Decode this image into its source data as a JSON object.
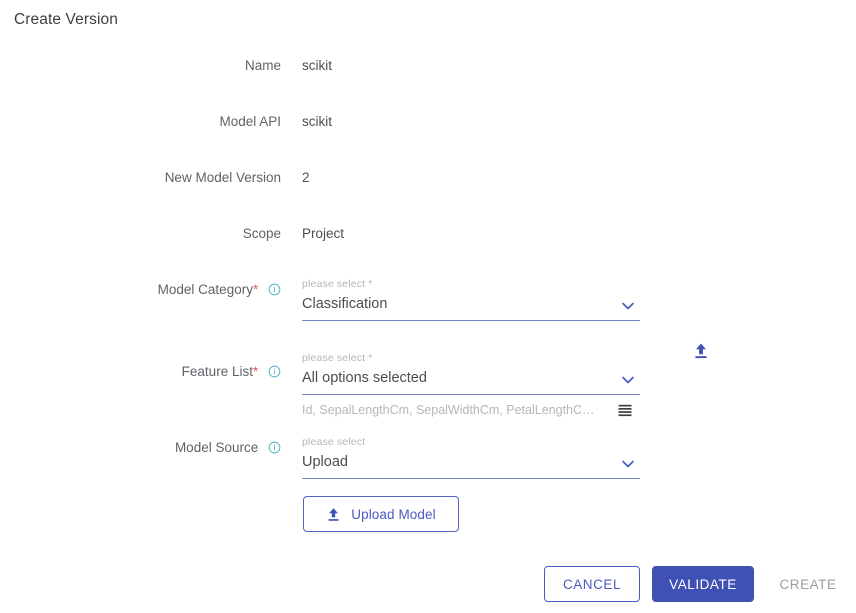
{
  "page": {
    "title": "Create Version"
  },
  "form": {
    "rows": [
      {
        "label": "Name",
        "value": "scikit"
      },
      {
        "label": "Model API",
        "value": "scikit"
      },
      {
        "label": "New Model Version",
        "value": "2"
      },
      {
        "label": "Scope",
        "value": "Project"
      }
    ],
    "selects": [
      {
        "label": "Model Category",
        "required": true,
        "info_icon": "info-icon",
        "float_label": "please select *",
        "value": "Classification",
        "chevron_icon": "chevron-down-icon",
        "helper": null
      },
      {
        "label": "Feature List",
        "required": true,
        "info_icon": "info-icon",
        "float_label": "please select *",
        "value": "All options selected",
        "chevron_icon": "chevron-down-icon",
        "helper": {
          "text": "Id, SepalLengthCm, SepalWidthCm, PetalLengthCm, Peta…",
          "icon": "list-icon"
        }
      },
      {
        "label": "Model Source",
        "required": false,
        "info_icon": "info-icon",
        "float_label": "please select",
        "value": "Upload",
        "chevron_icon": "chevron-down-icon",
        "helper": null
      }
    ]
  },
  "side_upload": {
    "icon": "upload-icon"
  },
  "upload_button": {
    "label": "Upload Model",
    "icon": "upload-icon"
  },
  "footer": {
    "cancel_label": "CANCEL",
    "validate_label": "VALIDATE",
    "create_label": "CREATE"
  },
  "colors": {
    "primary": "#3f51b5",
    "primary_outline": "#4a5bc0",
    "underline": "#7986cb",
    "required_star": "#e8555f",
    "info_icon": "#4fb3bf",
    "label_text": "#5f6368",
    "value_text": "#4a4d52",
    "muted_text": "#b4b6b9",
    "disabled_text": "#9aa0a6"
  }
}
